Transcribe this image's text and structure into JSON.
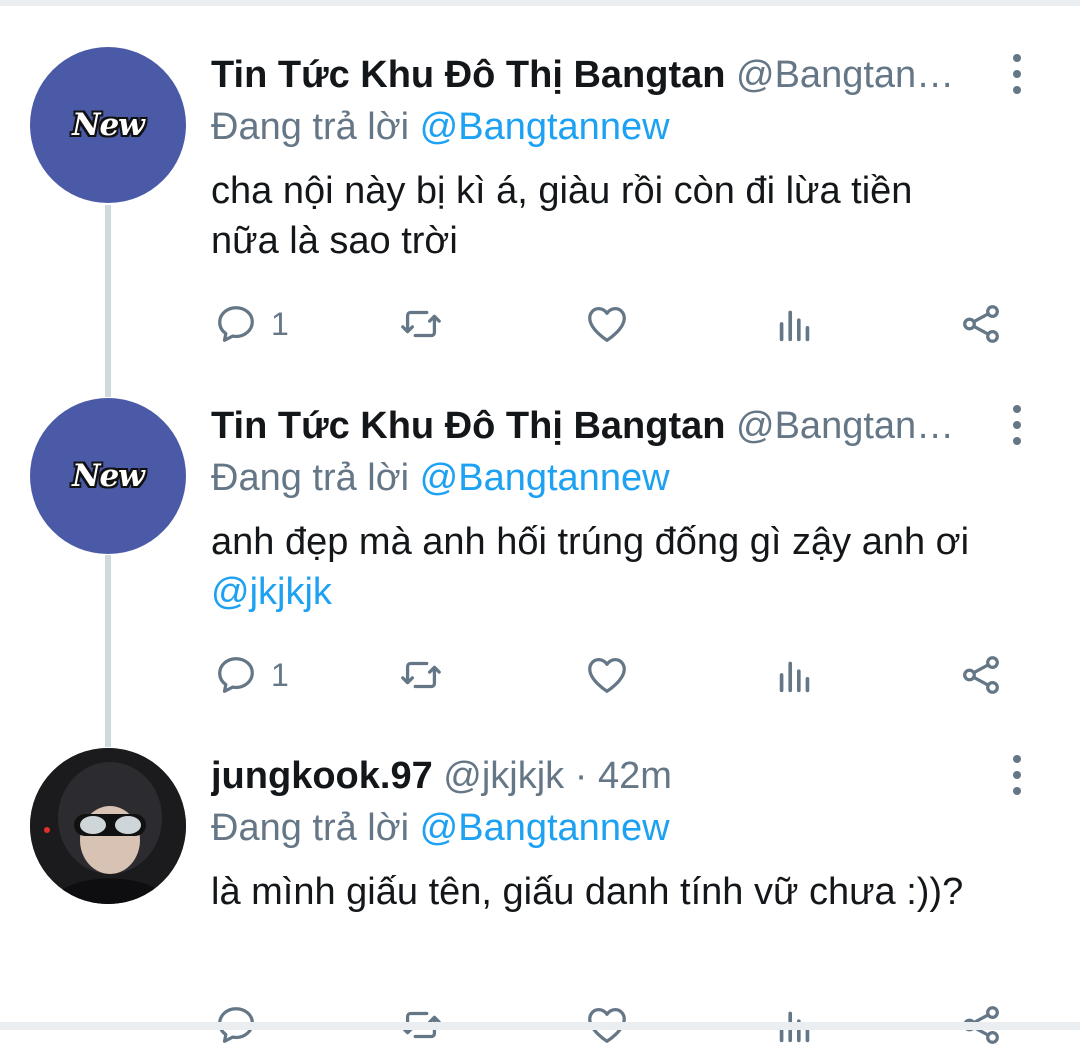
{
  "tweets": [
    {
      "name": "Tin Tức Khu Đô Thị Bangtan",
      "handle": "@Bangtan…",
      "time": "",
      "avatar_text": "New",
      "reply_prefix": "Đang trả lời",
      "reply_to": "@Bangtannew",
      "body_lines": [
        "cha nội này bị kì á, giàu rồi còn đi lừa tiền",
        "nữa là sao trời"
      ],
      "body_mention": "",
      "reply_count": "1"
    },
    {
      "name": "Tin Tức Khu Đô Thị Bangtan",
      "handle": "@Bangtan…",
      "time": "",
      "avatar_text": "New",
      "reply_prefix": "Đang trả lời",
      "reply_to": "@Bangtannew",
      "body_lines": [
        "anh đẹp mà anh hối trúng đống gì zậy anh ơi"
      ],
      "body_mention": "@jkjkjk",
      "reply_count": "1"
    },
    {
      "name": "jungkook.97",
      "handle": "@jkjkjk",
      "time": "· 42m",
      "avatar_text": "",
      "reply_prefix": "Đang trả lời",
      "reply_to": "@Bangtannew",
      "body_lines": [
        "là mình giấu tên, giấu danh tính vữ chưa :))?"
      ],
      "body_mention": "",
      "reply_count": ""
    }
  ],
  "colors": {
    "name": "#14171a",
    "secondary": "#657786",
    "mention": "#1da1f2",
    "avatar_bg": "#4a5aa6",
    "thread_line": "#cfd9de"
  },
  "icons": [
    "reply-icon",
    "retweet-icon",
    "like-icon",
    "analytics-icon",
    "share-icon",
    "more-icon"
  ]
}
